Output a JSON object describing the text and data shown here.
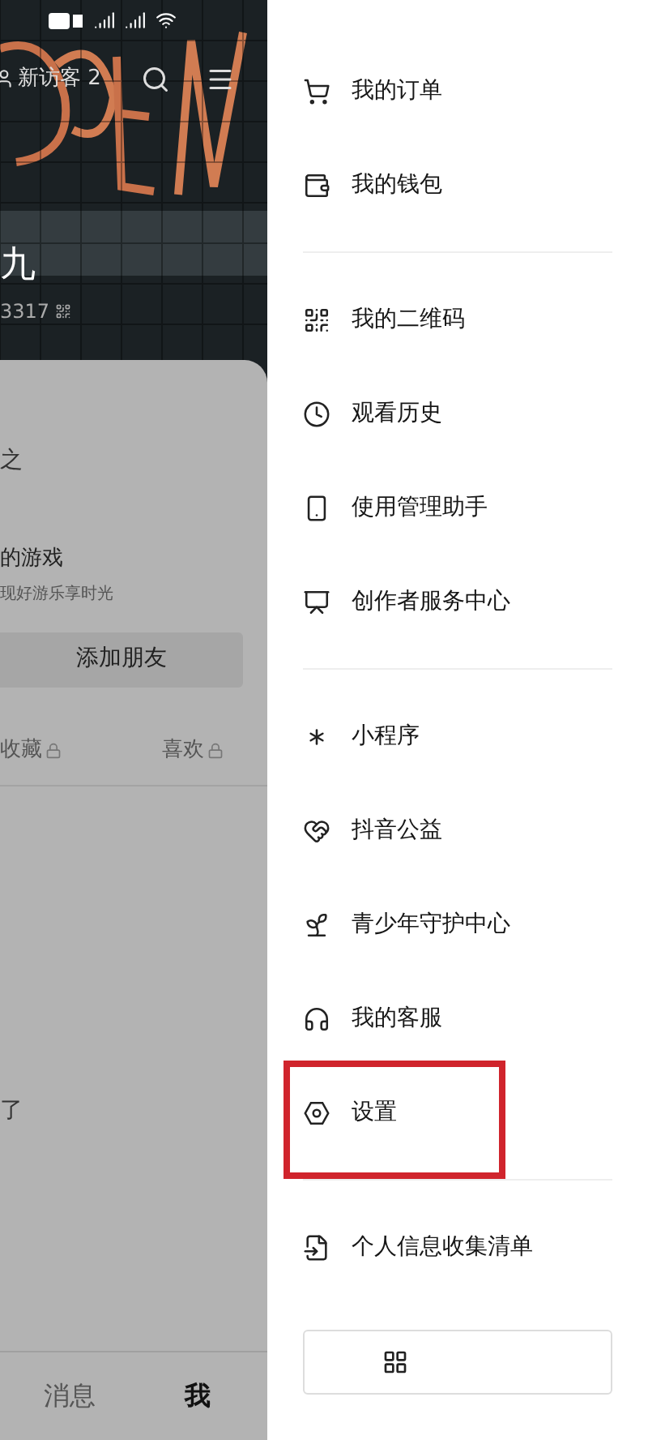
{
  "left_panel": {
    "header": {
      "visitor_label": "新访客 2"
    },
    "profile": {
      "name": "九",
      "id": "3317"
    },
    "card": {
      "line_1": "之",
      "game_title": "的游戏",
      "game_subtitle": "现好游乐享时光",
      "add_friend_button": "添加朋友",
      "tabs": [
        {
          "label": "收藏",
          "locked": true
        },
        {
          "label": "喜欢",
          "locked": true
        }
      ],
      "line_2": "了"
    },
    "bottom_nav": [
      {
        "label": "消息",
        "selected": false
      },
      {
        "label": "我",
        "selected": true
      }
    ]
  },
  "drawer": {
    "groups": [
      {
        "items": [
          {
            "label": "我的订单",
            "highlighted": false
          },
          {
            "label": "我的钱包",
            "highlighted": false
          }
        ]
      },
      {
        "items": [
          {
            "label": "我的二维码",
            "highlighted": false
          },
          {
            "label": "观看历史",
            "highlighted": false
          },
          {
            "label": "使用管理助手",
            "highlighted": false
          },
          {
            "label": "创作者服务中心",
            "highlighted": false
          }
        ]
      },
      {
        "items": [
          {
            "label": "小程序",
            "highlighted": false
          },
          {
            "label": "抖音公益",
            "highlighted": false
          },
          {
            "label": "青少年守护中心",
            "highlighted": false
          },
          {
            "label": "我的客服",
            "highlighted": false
          },
          {
            "label": "设置",
            "highlighted": true
          }
        ]
      },
      {
        "items": [
          {
            "label": "个人信息收集清单",
            "highlighted": false
          }
        ]
      }
    ]
  }
}
